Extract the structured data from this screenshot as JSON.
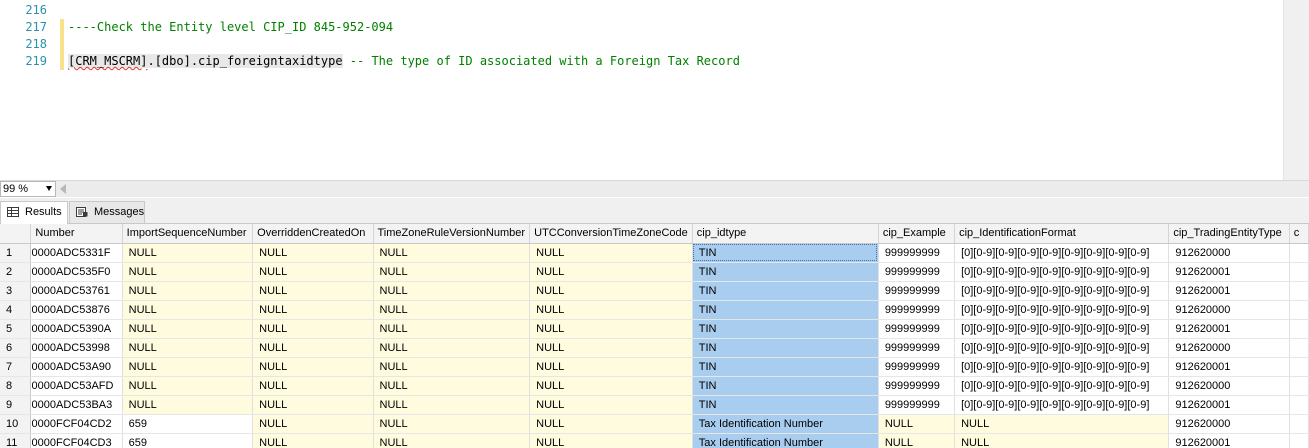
{
  "editor": {
    "lines": [
      {
        "num": "216",
        "parts": []
      },
      {
        "num": "217",
        "parts": [
          {
            "t": "----Check the Entity level CIP_ID 845-952-094",
            "k": "comment"
          }
        ]
      },
      {
        "num": "218",
        "parts": []
      },
      {
        "num": "219",
        "parts": [
          {
            "t": "[CRM_MSCRM]",
            "k": "ident-squig"
          },
          {
            "t": ".[dbo].cip_foreigntaxidtype",
            "k": "ident"
          },
          {
            "t": " -- The type of ID associated with a Foreign Tax Record",
            "k": "comment"
          }
        ]
      }
    ]
  },
  "zoom": {
    "value": "99 %"
  },
  "tabs": {
    "results": "Results",
    "messages": "Messages"
  },
  "grid": {
    "columns": [
      "",
      "Number",
      "ImportSequenceNumber",
      "OverriddenCreatedOn",
      "TimeZoneRuleVersionNumber",
      "UTCConversionTimeZoneCode",
      "cip_idtype",
      "cip_Example",
      "cip_IdentificationFormat",
      "cip_TradingEntityType",
      "c"
    ],
    "rows": [
      [
        "1",
        "00000ADC5331F",
        "NULL",
        "NULL",
        "NULL",
        "NULL",
        "TIN",
        "999999999",
        "[0][0-9][0-9][0-9][0-9][0-9][0-9][0-9][0-9]",
        "912620000",
        ""
      ],
      [
        "2",
        "00000ADC535F0",
        "NULL",
        "NULL",
        "NULL",
        "NULL",
        "TIN",
        "999999999",
        "[0][0-9][0-9][0-9][0-9][0-9][0-9][0-9][0-9]",
        "912620001",
        ""
      ],
      [
        "3",
        "00000ADC53761",
        "NULL",
        "NULL",
        "NULL",
        "NULL",
        "TIN",
        "999999999",
        "[0][0-9][0-9][0-9][0-9][0-9][0-9][0-9][0-9]",
        "912620001",
        ""
      ],
      [
        "4",
        "00000ADC53876",
        "NULL",
        "NULL",
        "NULL",
        "NULL",
        "TIN",
        "999999999",
        "[0][0-9][0-9][0-9][0-9][0-9][0-9][0-9][0-9]",
        "912620000",
        ""
      ],
      [
        "5",
        "00000ADC5390A",
        "NULL",
        "NULL",
        "NULL",
        "NULL",
        "TIN",
        "999999999",
        "[0][0-9][0-9][0-9][0-9][0-9][0-9][0-9][0-9]",
        "912620001",
        ""
      ],
      [
        "6",
        "00000ADC53998",
        "NULL",
        "NULL",
        "NULL",
        "NULL",
        "TIN",
        "999999999",
        "[0][0-9][0-9][0-9][0-9][0-9][0-9][0-9][0-9]",
        "912620000",
        ""
      ],
      [
        "7",
        "00000ADC53A90",
        "NULL",
        "NULL",
        "NULL",
        "NULL",
        "TIN",
        "999999999",
        "[0][0-9][0-9][0-9][0-9][0-9][0-9][0-9][0-9]",
        "912620001",
        ""
      ],
      [
        "8",
        "00000ADC53AFD",
        "NULL",
        "NULL",
        "NULL",
        "NULL",
        "TIN",
        "999999999",
        "[0][0-9][0-9][0-9][0-9][0-9][0-9][0-9][0-9]",
        "912620000",
        ""
      ],
      [
        "9",
        "00000ADC53BA3",
        "NULL",
        "NULL",
        "NULL",
        "NULL",
        "TIN",
        "999999999",
        "[0][0-9][0-9][0-9][0-9][0-9][0-9][0-9][0-9]",
        "912620001",
        ""
      ],
      [
        "10",
        "00000FCF04CD2",
        "659",
        "NULL",
        "NULL",
        "NULL",
        "Tax Identification Number",
        "NULL",
        "NULL",
        "912620000",
        ""
      ],
      [
        "11",
        "00000FCF04CD3",
        "659",
        "NULL",
        "NULL",
        "NULL",
        "Tax Identification Number",
        "NULL",
        "NULL",
        "912620001",
        ""
      ]
    ]
  },
  "colors": {
    "selection": "#a9cdef",
    "null_cell": "#fffbdf",
    "comment": "#008000",
    "line_number": "#2b91af"
  },
  "icons": {
    "results_tab": "grid-icon",
    "messages_tab": "messages-icon"
  }
}
